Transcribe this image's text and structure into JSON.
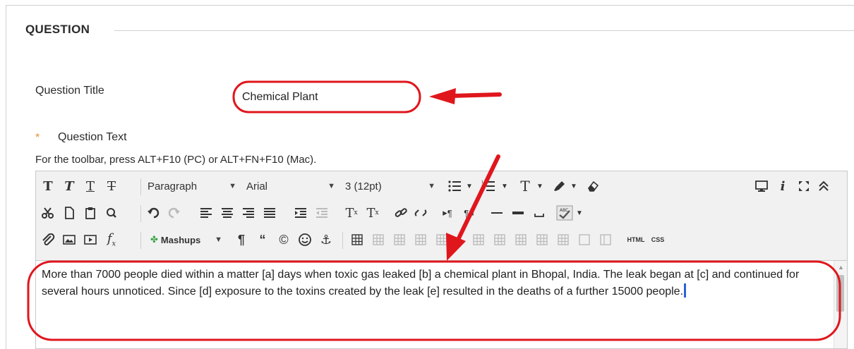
{
  "section": {
    "title": "QUESTION"
  },
  "question_title": {
    "label": "Question Title",
    "value": "Chemical Plant"
  },
  "question_text": {
    "required_marker": "*",
    "label": "Question Text",
    "toolbar_hint": "For the toolbar, press ALT+F10 (PC) or ALT+FN+F10 (Mac)."
  },
  "toolbar": {
    "row1": {
      "bold": "T",
      "italic": "T",
      "underline": "T",
      "strike": "T",
      "paragraph": "Paragraph",
      "font": "Arial",
      "size": "3 (12pt)",
      "text_color": "T",
      "info": "i"
    },
    "row2": {
      "superscript": "T",
      "subscript": "T",
      "para_ltr": "¶",
      "para_rtl": "¶"
    },
    "row3": {
      "mashups": "Mashups",
      "pilcrow": "¶",
      "quote": "“",
      "copyright": "©",
      "anchor": "⚓",
      "html": "HTML",
      "css": "CSS"
    }
  },
  "editor": {
    "content": "More than 7000 people died within a matter [a] days when toxic gas leaked [b] a chemical plant in Bhopal, India. The leak began at [c] and continued for several hours unnoticed. Since [d] exposure to the toxins created by the leak [e] resulted in the deaths of a further 15000 people."
  },
  "colors": {
    "annotation_red": "#e0161d",
    "required_star": "#e8923a",
    "cursor": "#2a62d6"
  }
}
